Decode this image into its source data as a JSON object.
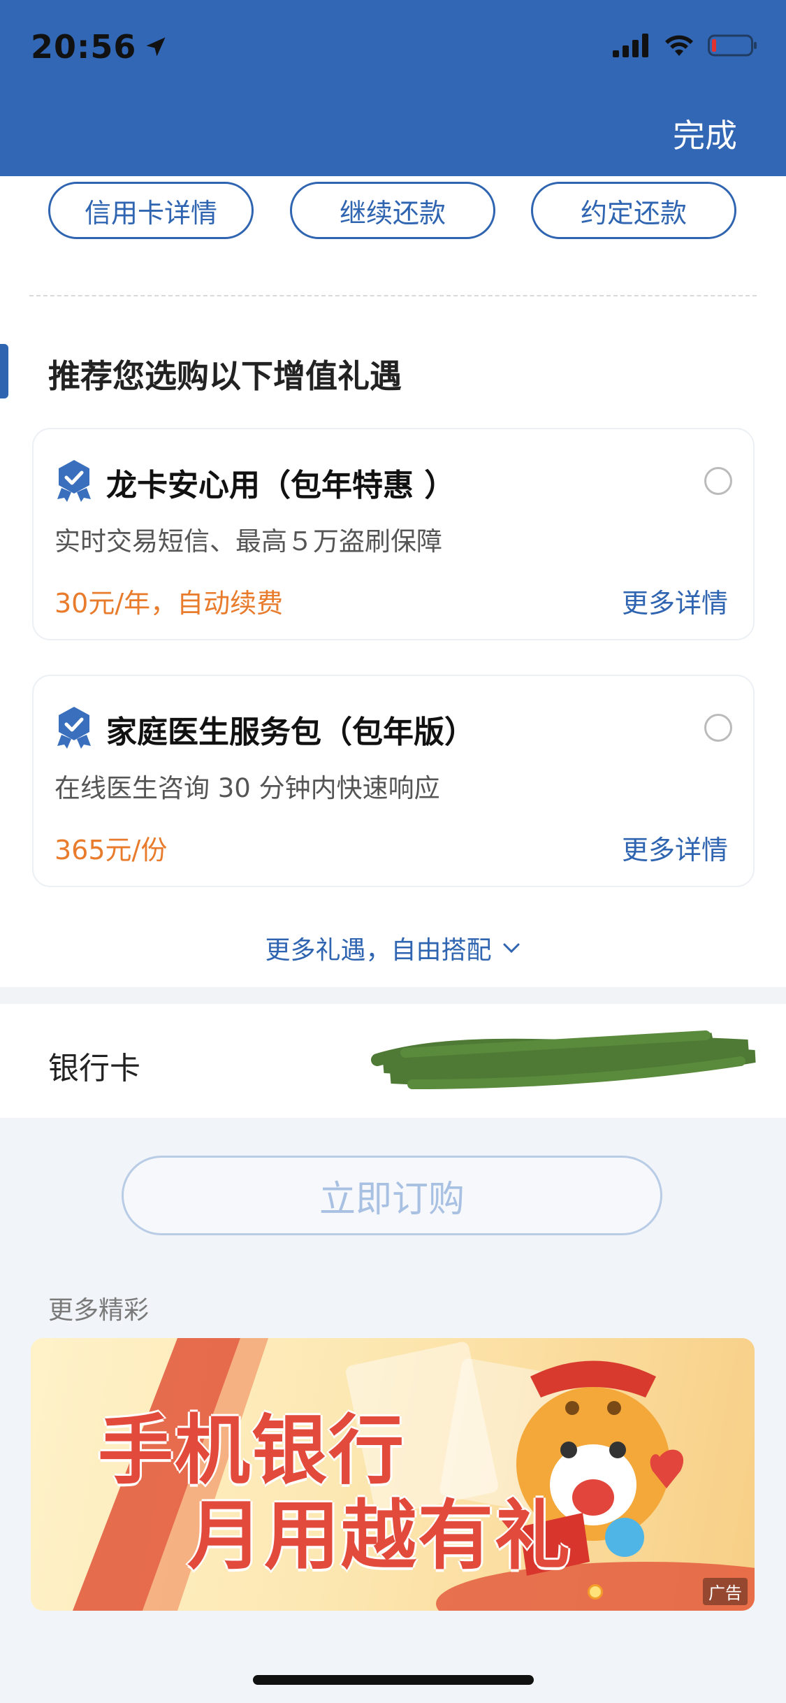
{
  "status_bar": {
    "time": "20:56"
  },
  "header": {
    "done_label": "完成"
  },
  "top_buttons": [
    "信用卡详情",
    "继续还款",
    "约定还款"
  ],
  "section_title": "推荐您选购以下增值礼遇",
  "offers": [
    {
      "title": "龙卡安心用（包年特惠 ）",
      "desc": "实时交易短信、最高５万盗刷保障",
      "price": "30元/年，自动续费",
      "more": "更多详情",
      "selected": false
    },
    {
      "title": "家庭医生服务包（包年版）",
      "desc": "在线医生咨询 30 分钟内快速响应",
      "price": "365元/份",
      "more": "更多详情",
      "selected": false
    }
  ],
  "more_offers_label": "更多礼遇，自由搭配",
  "bank_card": {
    "label": "银行卡",
    "value_redacted": true
  },
  "order_button": "立即订购",
  "more_section_label": "更多精彩",
  "banner": {
    "line1": "手机银行",
    "line2": "月用越有礼",
    "ad_label": "广告"
  },
  "colors": {
    "primary": "#2f64b0",
    "header": "#3167b4",
    "price": "#e87b2c",
    "banner_text": "#e24a3b"
  }
}
